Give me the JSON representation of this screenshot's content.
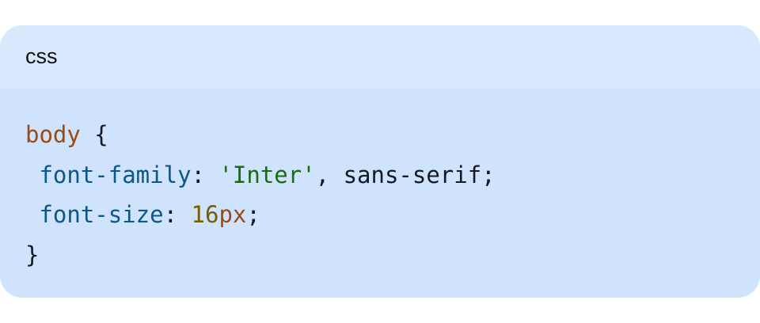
{
  "code_block": {
    "language_label": "css",
    "lines": {
      "l1": {
        "selector": "body",
        "brace_open": " {"
      },
      "l2": {
        "indent": " ",
        "prop": "font-family",
        "colon": ": ",
        "string": "'Inter'",
        "rest": ", sans-serif;"
      },
      "l3": {
        "indent": " ",
        "prop": "font-size",
        "colon": ": ",
        "number": "16",
        "unit": "px",
        "semi": ";"
      },
      "l4": {
        "brace_close": "}"
      }
    }
  },
  "colors": {
    "header_bg": "#d9e8fd",
    "body_bg": "#cfe3fc",
    "selector": "#9a4a13",
    "property": "#0c5787",
    "string": "#1a6b10",
    "number": "#7a5c00"
  }
}
